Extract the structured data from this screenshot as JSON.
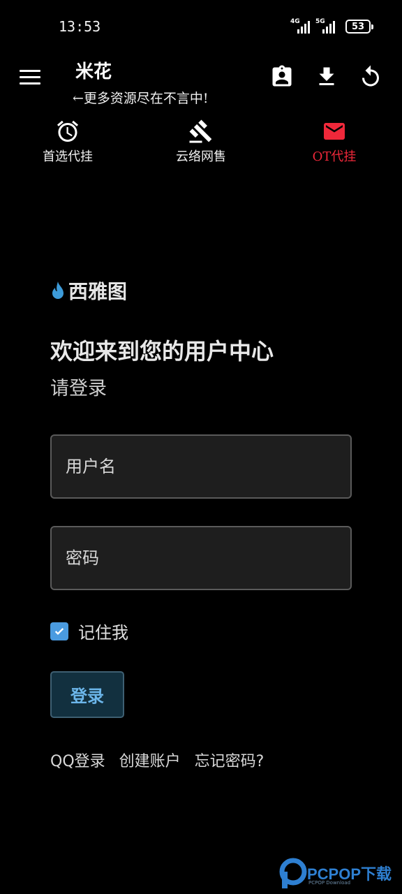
{
  "status_bar": {
    "time": "13:53",
    "signal_1_type": "4G",
    "signal_2_type": "5G",
    "battery": "53"
  },
  "app_bar": {
    "title": "米花",
    "subtitle": "←更多资源尽在不言中!",
    "icons": [
      "menu-icon",
      "contact-card-icon",
      "download-icon",
      "refresh-icon"
    ]
  },
  "tabs": [
    {
      "label": "首选代挂",
      "icon": "alarm-clock-icon",
      "active": false
    },
    {
      "label": "云络网售",
      "icon": "gavel-icon",
      "active": false
    },
    {
      "label": "OT代挂",
      "icon": "mail-icon",
      "active": true
    }
  ],
  "login": {
    "brand": "西雅图",
    "welcome": "欢迎来到您的用户中心",
    "prompt": "请登录",
    "username_placeholder": "用户名",
    "password_placeholder": "密码",
    "remember_label": "记住我",
    "remember_checked": true,
    "login_button": "登录",
    "links": {
      "qq_login": "QQ登录",
      "create_account": "创建账户",
      "forgot_password": "忘记密码?"
    }
  },
  "watermark": {
    "text": "PCPOP下载",
    "small": "PCPOP Download"
  },
  "colors": {
    "background": "#000000",
    "active_tab": "#f0283a",
    "accent_blue": "#4a9be0",
    "login_button_text": "#6cb6ea"
  }
}
